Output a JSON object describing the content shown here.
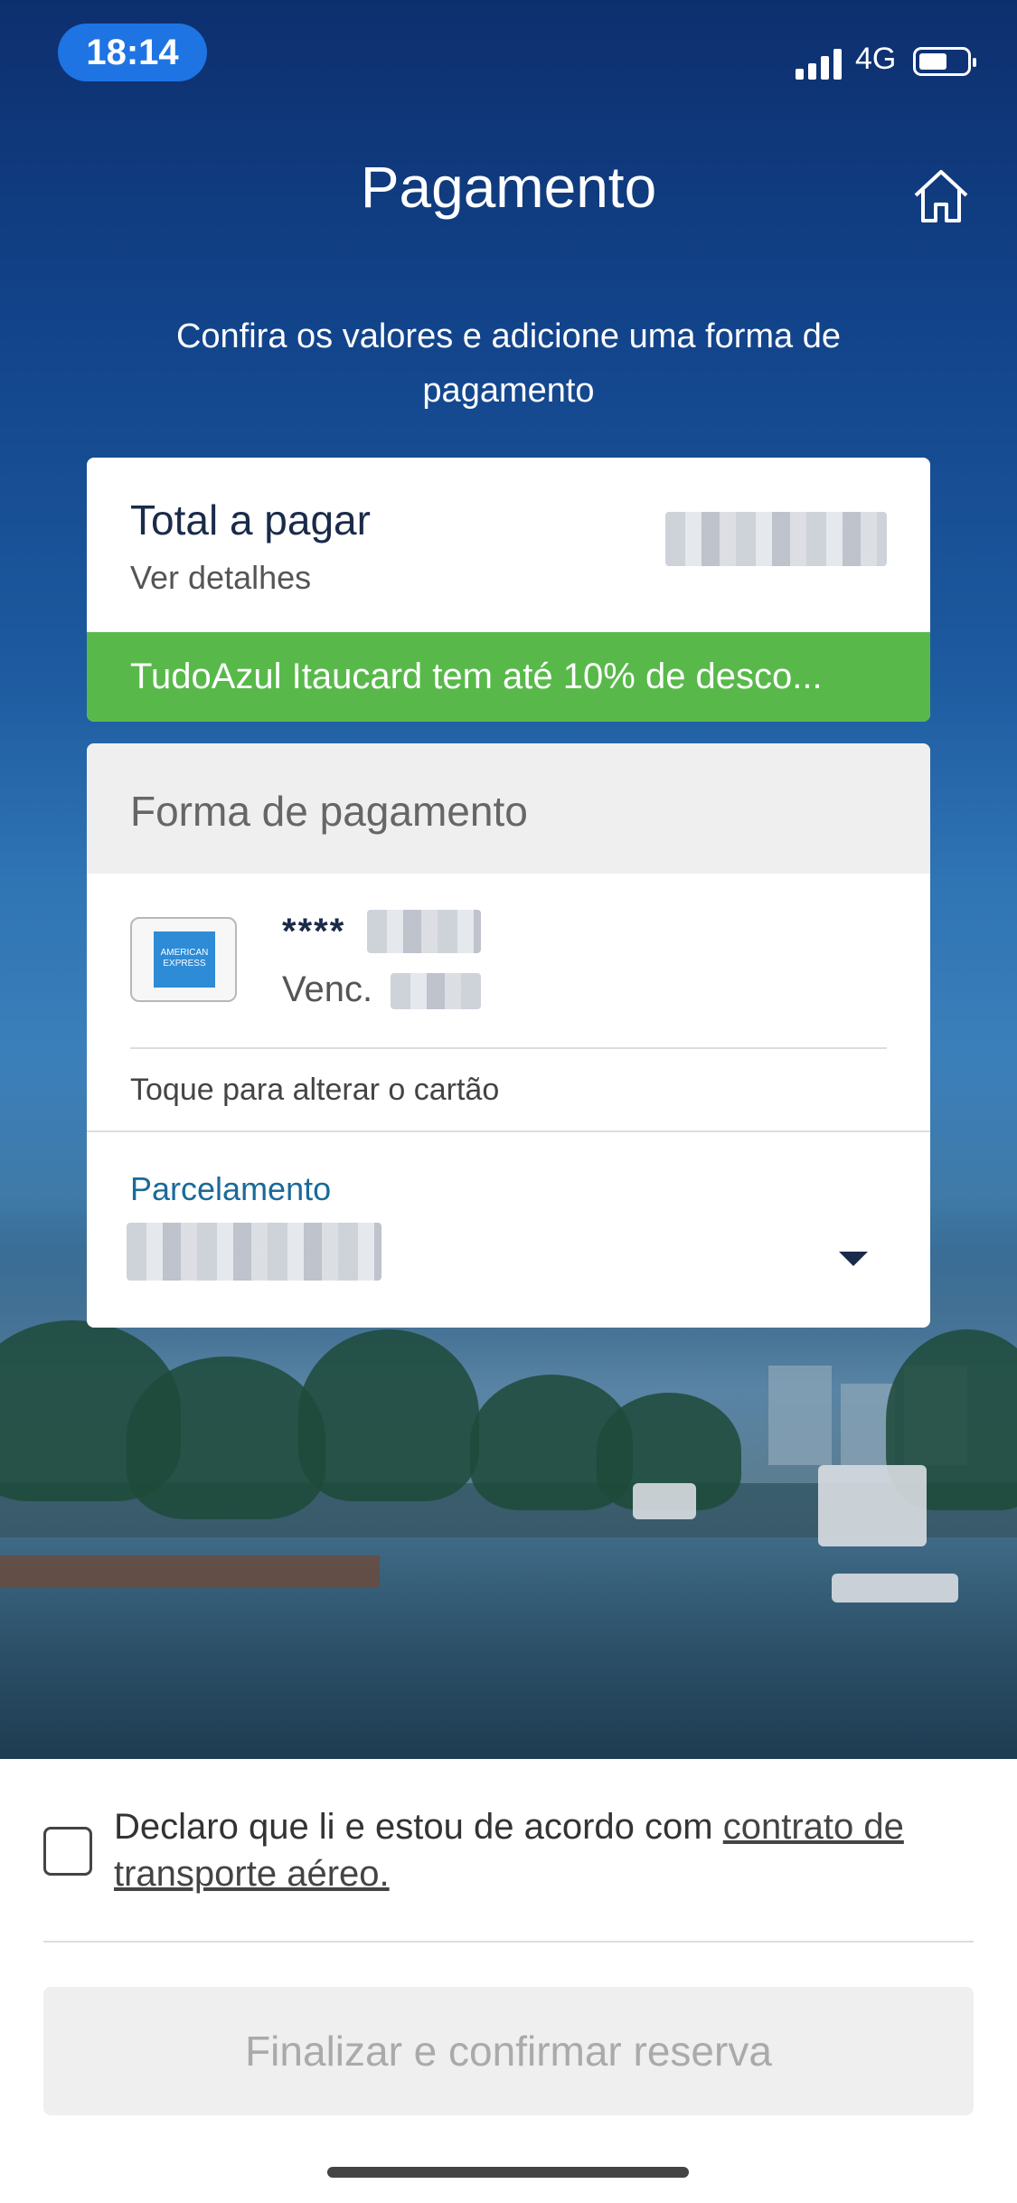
{
  "status_bar": {
    "time": "18:14",
    "network": "4G"
  },
  "header": {
    "title": "Pagamento",
    "home_icon": "home-icon"
  },
  "subtitle": "Confira os valores e adicione uma forma de pagamento",
  "total_card": {
    "label": "Total a pagar",
    "details_link": "Ver detalhes",
    "promo": "TudoAzul Itaucard tem até 10% de desco..."
  },
  "payment_card": {
    "header": "Forma de pagamento",
    "card_brand": "AMERICAN EXPRESS",
    "card_number_prefix": "****",
    "card_exp_label": "Venc.",
    "change_card": "Toque para alterar o cartão",
    "installments_label": "Parcelamento"
  },
  "consent": {
    "text": "Declaro que li e estou de acordo com ",
    "link": "contrato de transporte aéreo."
  },
  "confirm_button": "Finalizar e confirmar reserva",
  "colors": {
    "brand_blue": "#12438a",
    "promo_green": "#58b94a",
    "link_blue": "#1a6a9a"
  }
}
